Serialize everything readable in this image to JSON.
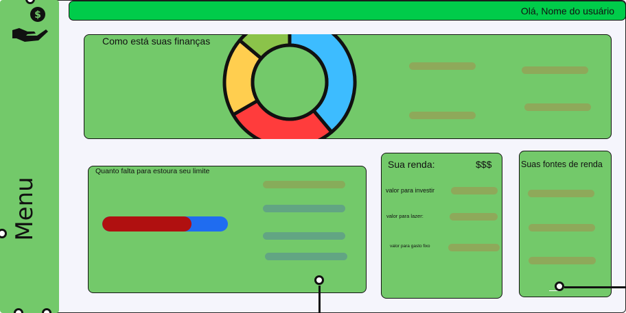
{
  "sidebar": {
    "menu_label": "Menu",
    "logo_icon": "money-hand-icon"
  },
  "topbar": {
    "greeting": "Olá, Nome do usuário"
  },
  "finances": {
    "title": "Como está suas finanças",
    "donut_colors": [
      "#3dbcff",
      "#ff3c3c",
      "#ffce4f",
      "#8bc34a"
    ]
  },
  "limit": {
    "title": "Quanto falta para estoura seu limite",
    "progress_fraction": 0.71,
    "used_color": "#b01010",
    "remaining_color": "#1f6cf0"
  },
  "income": {
    "title": "Sua renda:",
    "symbol": "$$$",
    "rows": [
      {
        "label": "valor para investir"
      },
      {
        "label": "valor para lazer:"
      },
      {
        "label": "valor para gasto fixo"
      }
    ]
  },
  "sources": {
    "title": "Suas fontes de renda"
  }
}
